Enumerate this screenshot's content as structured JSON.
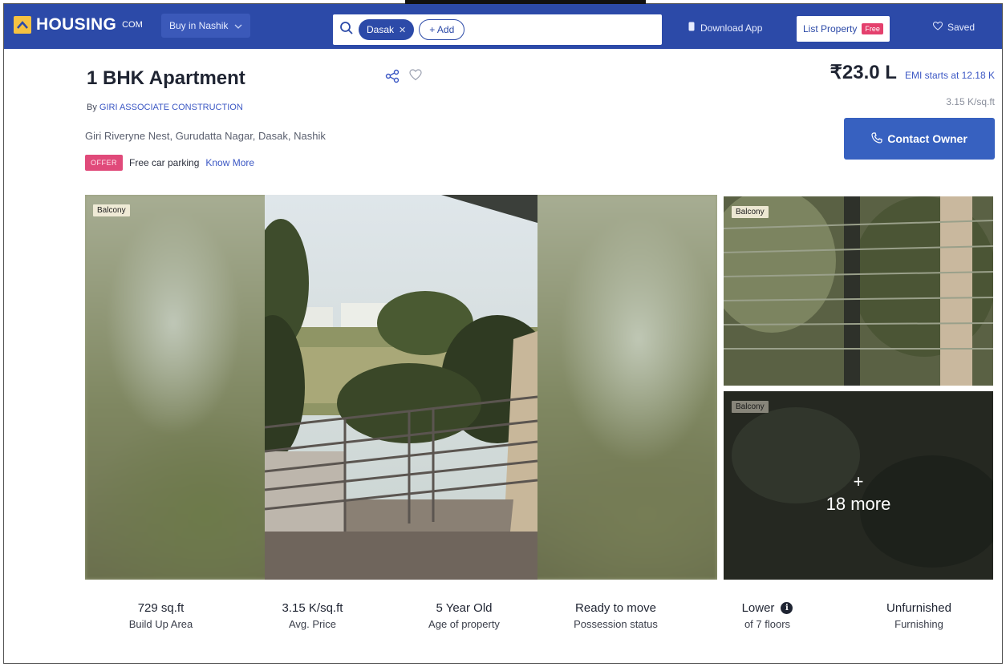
{
  "nav": {
    "logo_text": "HOUSING",
    "logo_sub": "COM",
    "city_select": "Buy in Nashik",
    "search_chip": "Dasak",
    "add_button": "+ Add",
    "download_app": "Download App",
    "list_property": "List Property",
    "free_badge": "Free",
    "saved": "Saved"
  },
  "listing": {
    "title": "1 BHK Apartment",
    "by_prefix": "By",
    "builder": "GIRI ASSOCIATE CONSTRUCTION",
    "address": "Giri Riveryne Nest, Gurudatta Nagar, Dasak, Nashik",
    "offer_tag": "OFFER",
    "offer_text": "Free car parking",
    "know_more": "Know More",
    "price": "₹23.0 L",
    "emi": "EMI starts at  12.18 K",
    "per_sqft": "3.15 K/sq.ft",
    "contact_button": "Contact Owner"
  },
  "gallery": {
    "main_label": "Balcony",
    "side_top_label": "Balcony",
    "side_bottom_label": "Balcony",
    "more_plus": "+",
    "more_text": "18 more"
  },
  "stats": [
    {
      "value": "729 sq.ft",
      "label": "Build Up Area"
    },
    {
      "value": "3.15 K/sq.ft",
      "label": "Avg. Price"
    },
    {
      "value": "5 Year Old",
      "label": "Age of property"
    },
    {
      "value": "Ready to move",
      "label": "Possession status"
    },
    {
      "value": "Lower",
      "label": "of 7 floors"
    },
    {
      "value": "Unfurnished",
      "label": "Furnishing"
    }
  ],
  "colors": {
    "brand": "#2c4aa8",
    "accent": "#3761c0",
    "offer": "#e04a7a",
    "logo": "#f5c242"
  }
}
